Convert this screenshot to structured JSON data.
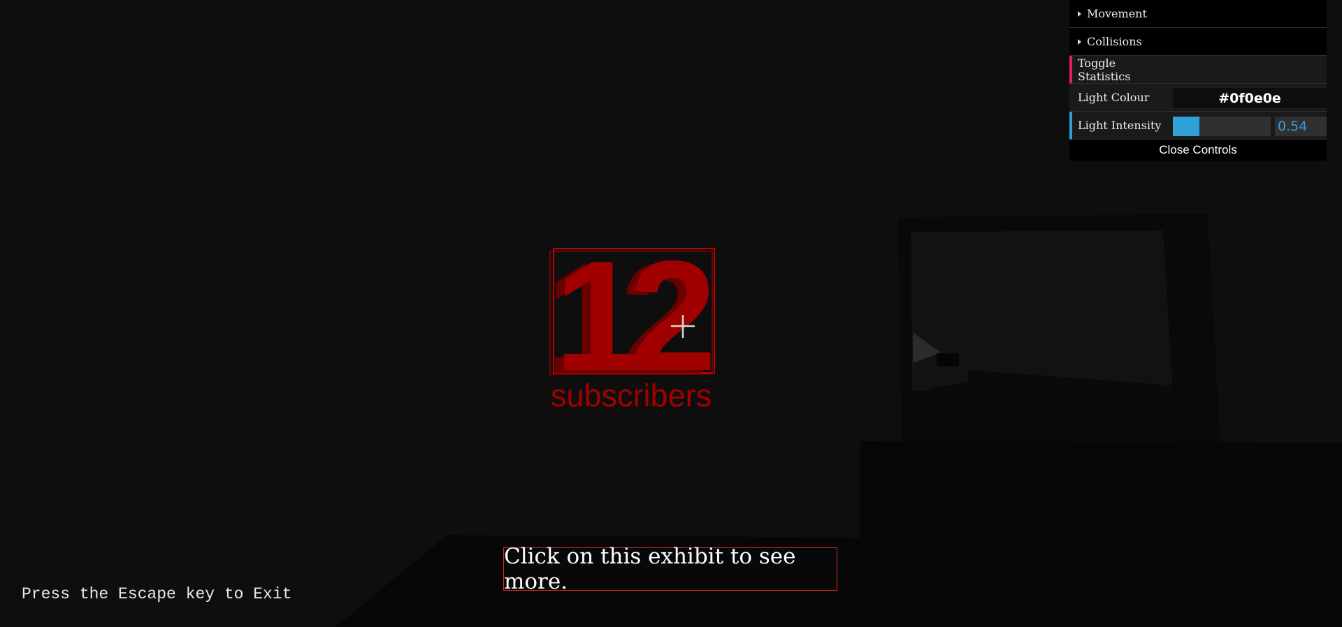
{
  "controls": {
    "folders": [
      {
        "label": "Movement"
      },
      {
        "label": "Collisions"
      }
    ],
    "toggle_statistics_label": "Toggle Statistics",
    "light_colour": {
      "label": "Light Colour",
      "value": "#0f0e0e"
    },
    "light_intensity": {
      "label": "Light Intensity",
      "value": 0.54,
      "display": "0.54",
      "fill_fraction": 0.27
    },
    "close_label": "Close Controls",
    "colors": {
      "function_accent": "#e61d5f",
      "number_accent": "#2fa1d6"
    }
  },
  "exhibit": {
    "number_text": "12",
    "subtitle_text": "subscribers",
    "color": "#a00000"
  },
  "caption": {
    "text": "Click on this exhibit to see more."
  },
  "exit_hint": {
    "text": "Press the Escape key to Exit"
  },
  "crosshair": {
    "icon": "crosshair-icon"
  }
}
